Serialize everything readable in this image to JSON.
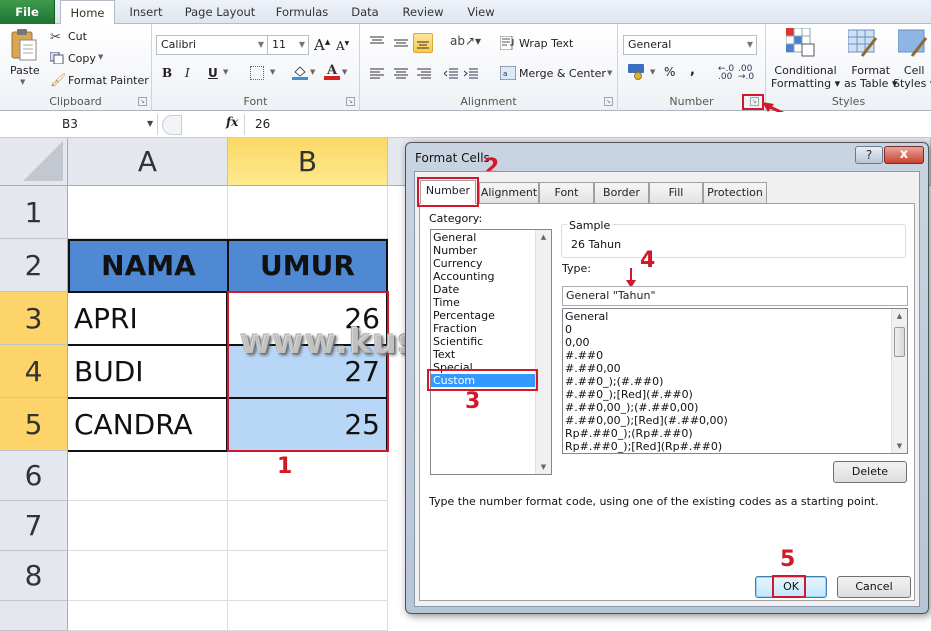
{
  "ribbon": {
    "tabs": [
      {
        "label": "File"
      },
      {
        "label": "Home"
      },
      {
        "label": "Insert"
      },
      {
        "label": "Page Layout"
      },
      {
        "label": "Formulas"
      },
      {
        "label": "Data"
      },
      {
        "label": "Review"
      },
      {
        "label": "View"
      }
    ],
    "active_tab": "Home",
    "clipboard": {
      "paste": "Paste",
      "cut": "Cut",
      "copy": "Copy",
      "format_painter": "Format Painter",
      "label": "Clipboard"
    },
    "font": {
      "name": "Calibri",
      "size": "11",
      "bold": "B",
      "italic": "I",
      "underline": "U",
      "label": "Font"
    },
    "alignment": {
      "wrap_text": "Wrap Text",
      "merge_center": "Merge & Center",
      "label": "Alignment"
    },
    "number": {
      "format": "General",
      "percent": "%",
      "comma": ",",
      "label": "Number"
    },
    "styles": {
      "conditional_1": "Conditional",
      "conditional_2": "Formatting",
      "format_table_1": "Format",
      "format_table_2": "as Table",
      "cell_styles_1": "Cell",
      "cell_styles_2": "Styles",
      "label": "Styles"
    }
  },
  "formula_bar": {
    "name_box": "B3",
    "fx": "fx",
    "value": "26"
  },
  "sheet": {
    "columns": [
      "A",
      "B"
    ],
    "rows": [
      "1",
      "2",
      "3",
      "4",
      "5",
      "6",
      "7",
      "8"
    ],
    "header_row": {
      "a": "NAMA",
      "b": "UMUR"
    },
    "data": [
      {
        "name": "APRI",
        "age": "26"
      },
      {
        "name": "BUDI",
        "age": "27"
      },
      {
        "name": "CANDRA",
        "age": "25"
      }
    ],
    "selected_range": "B3:B5",
    "header_fill": "#4f88d3",
    "selection_fill": "#b8d6f5"
  },
  "annotations": {
    "step1": "1",
    "step2": "2",
    "step3": "3",
    "step4": "4",
    "step5": "5",
    "color": "#d2182a"
  },
  "watermark": "www.kusnendar.web.id",
  "dialog": {
    "title": "Format Cells",
    "help": "?",
    "close": "x",
    "tabs": [
      "Number",
      "Alignment",
      "Font",
      "Border",
      "Fill",
      "Protection"
    ],
    "active_tab": "Number",
    "category_label": "Category:",
    "categories": [
      "General",
      "Number",
      "Currency",
      "Accounting",
      "Date",
      "Time",
      "Percentage",
      "Fraction",
      "Scientific",
      "Text",
      "Special",
      "Custom"
    ],
    "selected_category": "Custom",
    "sample_label": "Sample",
    "sample_value": "26 Tahun",
    "type_label": "Type:",
    "type_value": "General \"Tahun\"",
    "formats": [
      "General",
      "0",
      "0,00",
      "#.##0",
      "#.##0,00",
      "#.##0_);(#.##0)",
      "#.##0_);[Red](#.##0)",
      "#.##0,00_);(#.##0,00)",
      "#.##0,00_);[Red](#.##0,00)",
      "Rp#.##0_);(Rp#.##0)",
      "Rp#.##0_);[Red](Rp#.##0)"
    ],
    "delete_label": "Delete",
    "hint": "Type the number format code, using one of the existing codes as a starting point.",
    "ok_label": "OK",
    "cancel_label": "Cancel"
  }
}
